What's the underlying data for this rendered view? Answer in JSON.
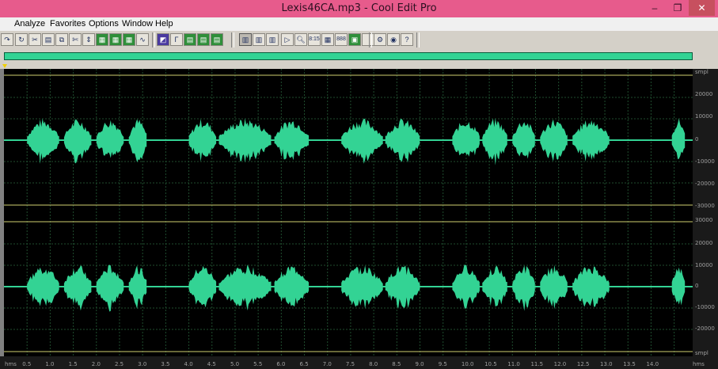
{
  "window": {
    "title": "Lexis46CA.mp3 - Cool Edit Pro",
    "minimize_glyph": "‒",
    "maximize_glyph": "❐",
    "close_glyph": "✕"
  },
  "menu": [
    "Analyze",
    "Favorites",
    "Options",
    "Window",
    "Help"
  ],
  "toolbar_icons": [
    "redo-icon",
    "loop-icon",
    "cut-icon",
    "copy-icon",
    "scissors-icon",
    "paste-icon",
    "mix-icon",
    "green-tool-1-icon",
    "green-tool-2-icon",
    "green-tool-3-icon",
    "waveform-icon",
    "envelope-icon",
    "spectral-icon",
    "multitrack-1-icon",
    "multitrack-2-icon",
    "view-1-icon",
    "view-2-icon",
    "view-3-icon",
    "play-icon",
    "zoom-icon",
    "time-display-icon",
    "counter-icon",
    "cue-icon",
    "blank-icon",
    "settings-icon",
    "record-icon",
    "help-icon"
  ],
  "toolbar_text": {
    "time_display": "8:15",
    "counter": "888",
    "help": "?"
  },
  "colors": {
    "waveform": "#33d394",
    "background": "#000000",
    "grid": "#1f4d2e",
    "title_bar": "#e75b8c"
  },
  "channel_ruler": {
    "top": [
      "smpl",
      "20000",
      "10000",
      "0",
      "-10000",
      "-20000",
      "-30000"
    ],
    "bottom": [
      "30000",
      "20000",
      "10000",
      "0",
      "-10000",
      "-20000",
      "smpl"
    ]
  },
  "time_ruler": {
    "start_label": "hms",
    "end_label": "hms",
    "ticks": [
      "0.5",
      "1.0",
      "1.5",
      "2.0",
      "2.5",
      "3.0",
      "3.5",
      "4.0",
      "4.5",
      "5.0",
      "5.5",
      "6.0",
      "6.5",
      "7.0",
      "7.5",
      "8.0",
      "8.5",
      "9.0",
      "9.5",
      "10.0",
      "10.5",
      "11.0",
      "11.5",
      "12.0",
      "12.5",
      "13.0",
      "13.5",
      "14.0"
    ],
    "duration_seconds": 14.9
  },
  "waveform_segments_seconds": [
    [
      0.5,
      1.2
    ],
    [
      1.3,
      1.9
    ],
    [
      2.0,
      2.6
    ],
    [
      2.7,
      3.1
    ],
    [
      4.0,
      4.6
    ],
    [
      4.65,
      5.8
    ],
    [
      5.85,
      6.6
    ],
    [
      7.3,
      8.2
    ],
    [
      8.25,
      9.0
    ],
    [
      9.7,
      10.3
    ],
    [
      10.35,
      10.9
    ],
    [
      11.0,
      11.5
    ],
    [
      11.6,
      12.2
    ],
    [
      12.3,
      13.1
    ],
    [
      14.45,
      14.75
    ]
  ]
}
